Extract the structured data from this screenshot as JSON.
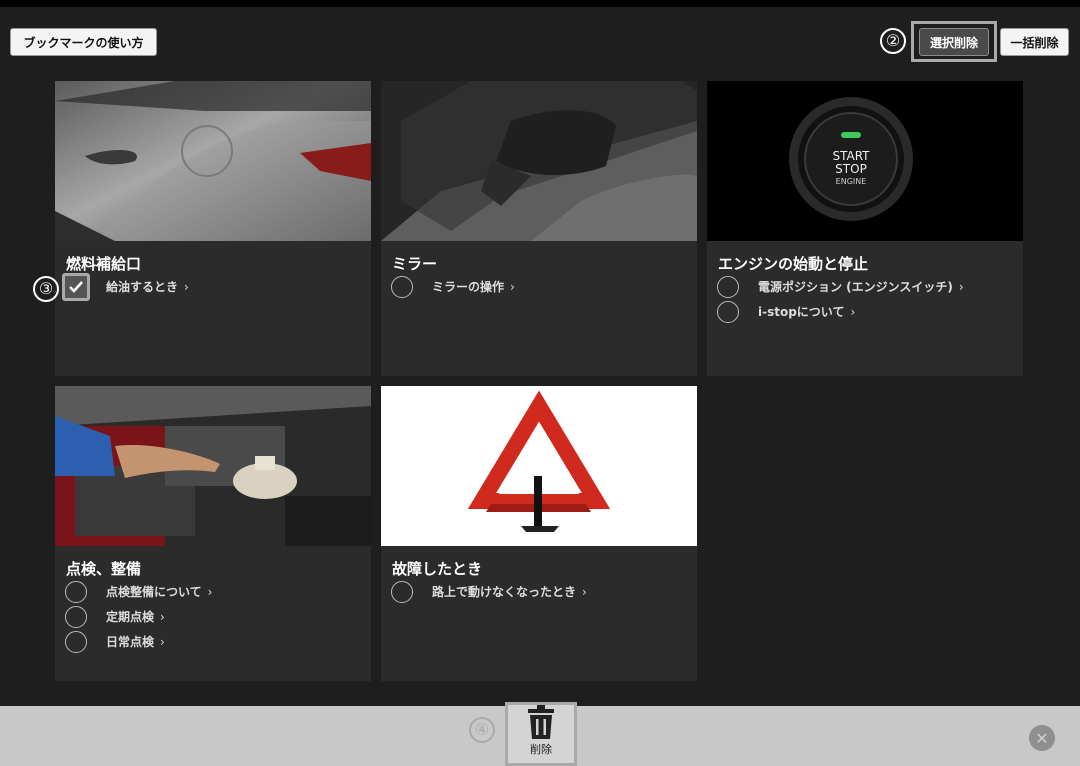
{
  "header": {
    "howto_button": "ブックマークの使い方",
    "select_delete_button": "選択削除",
    "delete_all_button": "一括削除",
    "marker_2": "②"
  },
  "cards": [
    {
      "title": "燃料補給口",
      "marker": "③",
      "items": [
        {
          "label": "給油するとき",
          "checked": true
        }
      ]
    },
    {
      "title": "ミラー",
      "items": [
        {
          "label": "ミラーの操作",
          "checked": false
        }
      ]
    },
    {
      "title": "エンジンの始動と停止",
      "image_text": [
        "START",
        "STOP",
        "ENGINE"
      ],
      "items": [
        {
          "label": "電源ポジション (エンジンスイッチ)",
          "checked": false
        },
        {
          "label": "i-stopについて",
          "checked": false
        }
      ]
    },
    {
      "title": "点検、整備",
      "items": [
        {
          "label": "点検整備について",
          "checked": false
        },
        {
          "label": "定期点検",
          "checked": false
        },
        {
          "label": "日常点検",
          "checked": false
        }
      ]
    },
    {
      "title": "故障したとき",
      "items": [
        {
          "label": "路上で動けなくなったとき",
          "checked": false
        }
      ]
    }
  ],
  "footer": {
    "marker_4": "④",
    "delete_label": "削除",
    "close_icon": "close-icon",
    "trash_icon": "trash-icon"
  },
  "colors": {
    "background": "#1e1e1e",
    "card": "#2b2b2b",
    "bottombar": "#c8c8c8",
    "highlight_frame": "#a9a9a9"
  }
}
